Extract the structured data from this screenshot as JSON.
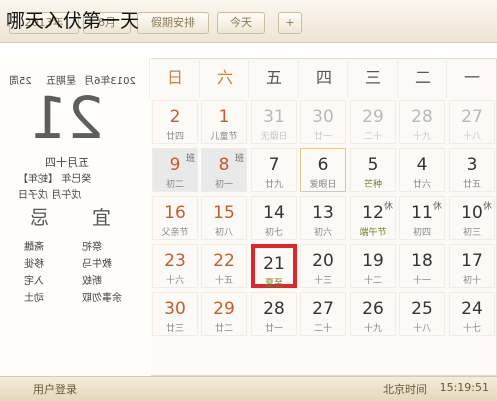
{
  "overlay_title": "哪天入伏第一天",
  "toolbar": {
    "year": "2013年",
    "month": "6月",
    "holiday": "假期安排",
    "today": "今天",
    "add": "+"
  },
  "info": {
    "ym": "2013年6月",
    "wk": "星期五",
    "d": "25周",
    "big": "21",
    "lunar": "五月十四",
    "yr1": "癸巳年",
    "animal": "【蛇年】",
    "ganzhi": "戊午月 戊子日",
    "ji": "忌",
    "yi": "宜",
    "ji_items": [
      "斋醮",
      "移徙",
      "入宅",
      "动土"
    ],
    "yi_items": [
      "祭祀",
      "教牛马",
      "断蚁",
      "余事勿取"
    ]
  },
  "weekdays": [
    "一",
    "二",
    "三",
    "四",
    "五",
    "六",
    "日"
  ],
  "days": [
    {
      "n": "27",
      "l": "十八",
      "o": true
    },
    {
      "n": "28",
      "l": "十九",
      "o": true
    },
    {
      "n": "29",
      "l": "二十",
      "o": true
    },
    {
      "n": "30",
      "l": "廿一",
      "o": true
    },
    {
      "n": "31",
      "l": "无烟日",
      "o": true
    },
    {
      "n": "1",
      "l": "儿童节",
      "w": true
    },
    {
      "n": "2",
      "l": "廿四",
      "w": true
    },
    {
      "n": "3",
      "l": "廿五"
    },
    {
      "n": "4",
      "l": "廿六"
    },
    {
      "n": "5",
      "l": "芒种",
      "f": true
    },
    {
      "n": "6",
      "l": "爱眼日",
      "sel": true
    },
    {
      "n": "7",
      "l": "廿九"
    },
    {
      "n": "8",
      "l": "初一",
      "w": true,
      "b": "班",
      "g": true
    },
    {
      "n": "9",
      "l": "初二",
      "w": true,
      "b": "班",
      "g": true
    },
    {
      "n": "10",
      "l": "初三",
      "b": "休"
    },
    {
      "n": "11",
      "l": "初四",
      "b": "休"
    },
    {
      "n": "12",
      "l": "端午节",
      "b": "休",
      "f": true
    },
    {
      "n": "13",
      "l": "初六"
    },
    {
      "n": "14",
      "l": "初七"
    },
    {
      "n": "15",
      "l": "初八",
      "w": true
    },
    {
      "n": "16",
      "l": "父亲节",
      "w": true
    },
    {
      "n": "17",
      "l": "初十"
    },
    {
      "n": "18",
      "l": "十一"
    },
    {
      "n": "19",
      "l": "十二"
    },
    {
      "n": "20",
      "l": "十三"
    },
    {
      "n": "21",
      "l": "夏至",
      "t": true,
      "f": true
    },
    {
      "n": "22",
      "l": "十五",
      "w": true
    },
    {
      "n": "23",
      "l": "十六",
      "w": true
    },
    {
      "n": "24",
      "l": "十七"
    },
    {
      "n": "25",
      "l": "十八"
    },
    {
      "n": "26",
      "l": "十九"
    },
    {
      "n": "27",
      "l": "二十"
    },
    {
      "n": "28",
      "l": "廿一"
    },
    {
      "n": "29",
      "l": "廿二",
      "w": true
    },
    {
      "n": "30",
      "l": "廿三",
      "w": true
    }
  ],
  "status": {
    "login": "用户登录",
    "clock_label": "北京时间",
    "clock": "15:19:51"
  }
}
